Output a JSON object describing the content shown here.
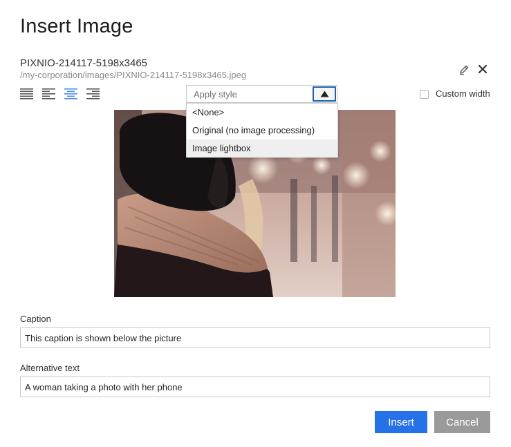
{
  "dialog": {
    "title": "Insert Image"
  },
  "file": {
    "name": "PIXNIO-214117-5198x3465",
    "path": "/my-corporation/images/PIXNIO-214117-5198x3465.jpeg"
  },
  "header_icons": {
    "edit": "pencil-icon",
    "close": "close-icon"
  },
  "alignment": {
    "options": [
      "justify",
      "align-left",
      "align-center",
      "align-right"
    ],
    "selected": "align-center",
    "active_color": "#4a8fe7",
    "inactive_color": "#555555"
  },
  "style_select": {
    "placeholder": "Apply style",
    "expanded": true,
    "options": [
      {
        "label": "<None>"
      },
      {
        "label": "Original (no image processing)"
      },
      {
        "label": "Image lightbox"
      }
    ],
    "hovered_index": 2
  },
  "custom_width": {
    "label": "Custom width",
    "checked": false
  },
  "preview": {
    "alt": "A woman taking a photo with her phone"
  },
  "caption": {
    "label": "Caption",
    "value": "This caption is shown below the picture"
  },
  "alt_text": {
    "label": "Alternative text",
    "value": "A woman taking a photo with her phone"
  },
  "actions": {
    "insert_label": "Insert",
    "cancel_label": "Cancel"
  },
  "colors": {
    "primary": "#2572e8",
    "secondary": "#9a9a9a",
    "focus_border": "#1f5fb3"
  }
}
